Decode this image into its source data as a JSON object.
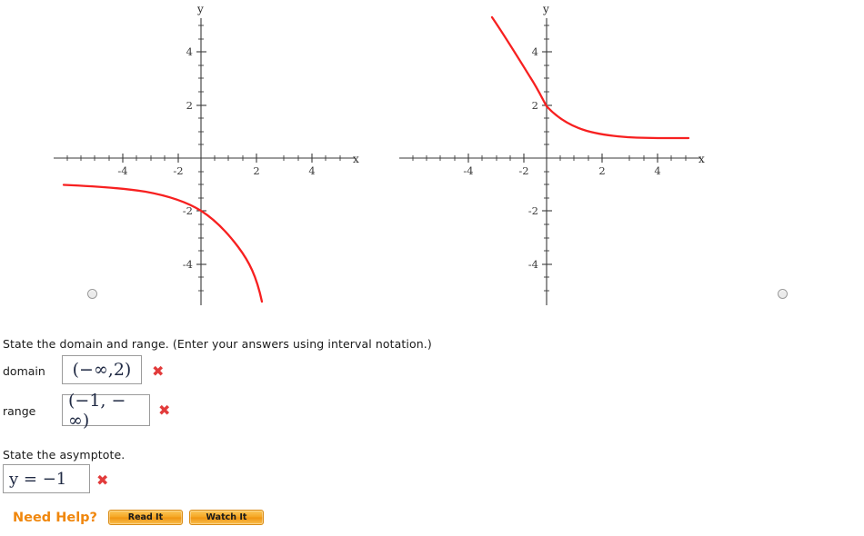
{
  "graphs": {
    "axis": {
      "x_label": "x",
      "y_label": "y",
      "x_ticks": [
        "-4",
        "-2",
        "2",
        "4"
      ],
      "y_ticks": [
        "4",
        "2",
        "-2",
        "-4"
      ],
      "x_range": [
        -5.3,
        5.3
      ],
      "y_range": [
        -5.3,
        5.3
      ],
      "curve_color": "#f72020",
      "axis_color": "#3a3a3a"
    },
    "panels": [
      {
        "id": "graph-1",
        "selected": false,
        "radio_name": "graph-choice-1"
      },
      {
        "id": "graph-2",
        "selected": false,
        "radio_name": "graph-choice-2"
      }
    ]
  },
  "chart_data": [
    {
      "type": "line",
      "title": "",
      "xlabel": "x",
      "ylabel": "y",
      "xlim": [
        -5.3,
        5.3
      ],
      "ylim": [
        -5.3,
        5.3
      ],
      "grid": false,
      "legend": "none",
      "annotations": [
        "y-intercept at (0, -2)",
        "horizontal asymptote y = -1 as x -> -inf"
      ],
      "series": [
        {
          "name": "curve-left-panel",
          "x": [
            -5.0,
            -4.5,
            -4.0,
            -3.5,
            -3.0,
            -2.5,
            -2.0,
            -1.5,
            -1.0,
            -0.5,
            0.0,
            0.5,
            1.0,
            1.5,
            2.0,
            2.2
          ],
          "y": [
            -1.02,
            -1.03,
            -1.04,
            -1.06,
            -1.09,
            -1.13,
            -1.19,
            -1.27,
            -1.4,
            -1.62,
            -2.0,
            -2.54,
            -3.0,
            -3.65,
            -4.5,
            -5.2
          ]
        }
      ]
    },
    {
      "type": "line",
      "title": "",
      "xlabel": "x",
      "ylabel": "y",
      "xlim": [
        -5.3,
        5.3
      ],
      "ylim": [
        -5.3,
        5.3
      ],
      "grid": false,
      "legend": "none",
      "annotations": [
        "y-intercept at (0, 2)",
        "horizontal asymptote y = 1 as x -> +inf"
      ],
      "series": [
        {
          "name": "curve-right-panel",
          "x": [
            -2.05,
            -1.8,
            -1.5,
            -1.0,
            -0.5,
            0.0,
            0.5,
            1.0,
            1.5,
            2.0,
            2.5,
            3.0,
            3.5,
            4.0,
            4.5,
            5.0
          ],
          "y": [
            5.3,
            4.45,
            3.7,
            2.73,
            2.32,
            2.0,
            1.76,
            1.58,
            1.44,
            1.33,
            1.25,
            1.19,
            1.14,
            1.11,
            1.09,
            1.07
          ]
        }
      ]
    }
  ],
  "questions": {
    "domain_range_prompt": "State the domain and range. (Enter your answers using interval notation.)",
    "domain_label": "domain",
    "domain_value": "(−∞,2)",
    "domain_status": "✖",
    "range_label": "range",
    "range_value": "(−1, − ∞)",
    "range_status": "✖",
    "asymptote_prompt": "State the asymptote.",
    "asymptote_value": "y = −1",
    "asymptote_status": "✖"
  },
  "help": {
    "label": "Need Help?",
    "read_it": "Read It",
    "watch_it": "Watch It"
  },
  "colors": {
    "curve": "#f72020",
    "incorrect": "#e23b3b",
    "help_accent": "#f0870d"
  }
}
